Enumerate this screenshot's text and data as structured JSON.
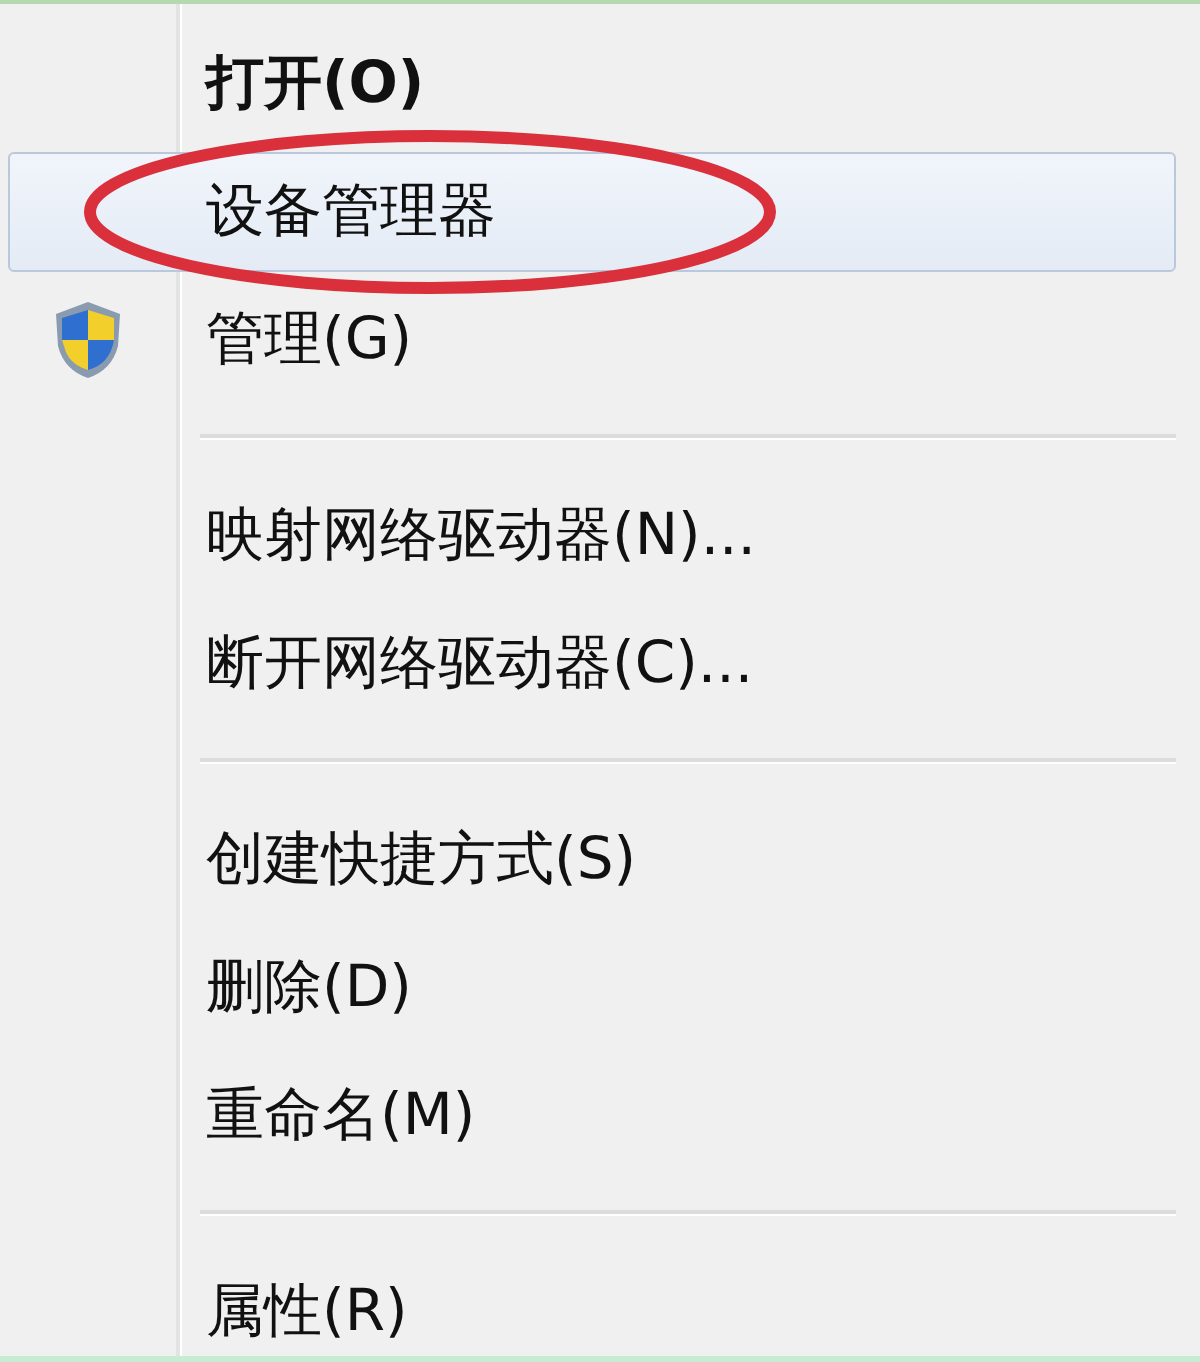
{
  "menu": {
    "items": [
      {
        "kind": "item",
        "label": "打开(O)",
        "bold": true,
        "selected": false,
        "has_icon": false
      },
      {
        "kind": "item",
        "label": "设备管理器",
        "bold": false,
        "selected": true,
        "has_icon": false
      },
      {
        "kind": "item",
        "label": "管理(G)",
        "bold": false,
        "selected": false,
        "has_icon": true
      },
      {
        "kind": "separator"
      },
      {
        "kind": "item",
        "label": "映射网络驱动器(N)...",
        "bold": false,
        "selected": false,
        "has_icon": false
      },
      {
        "kind": "item",
        "label": "断开网络驱动器(C)...",
        "bold": false,
        "selected": false,
        "has_icon": false
      },
      {
        "kind": "separator"
      },
      {
        "kind": "item",
        "label": "创建快捷方式(S)",
        "bold": false,
        "selected": false,
        "has_icon": false
      },
      {
        "kind": "item",
        "label": "删除(D)",
        "bold": false,
        "selected": false,
        "has_icon": false
      },
      {
        "kind": "item",
        "label": "重命名(M)",
        "bold": false,
        "selected": false,
        "has_icon": false
      },
      {
        "kind": "separator"
      },
      {
        "kind": "item",
        "label": "属性(R)",
        "bold": false,
        "selected": false,
        "has_icon": false
      }
    ]
  }
}
